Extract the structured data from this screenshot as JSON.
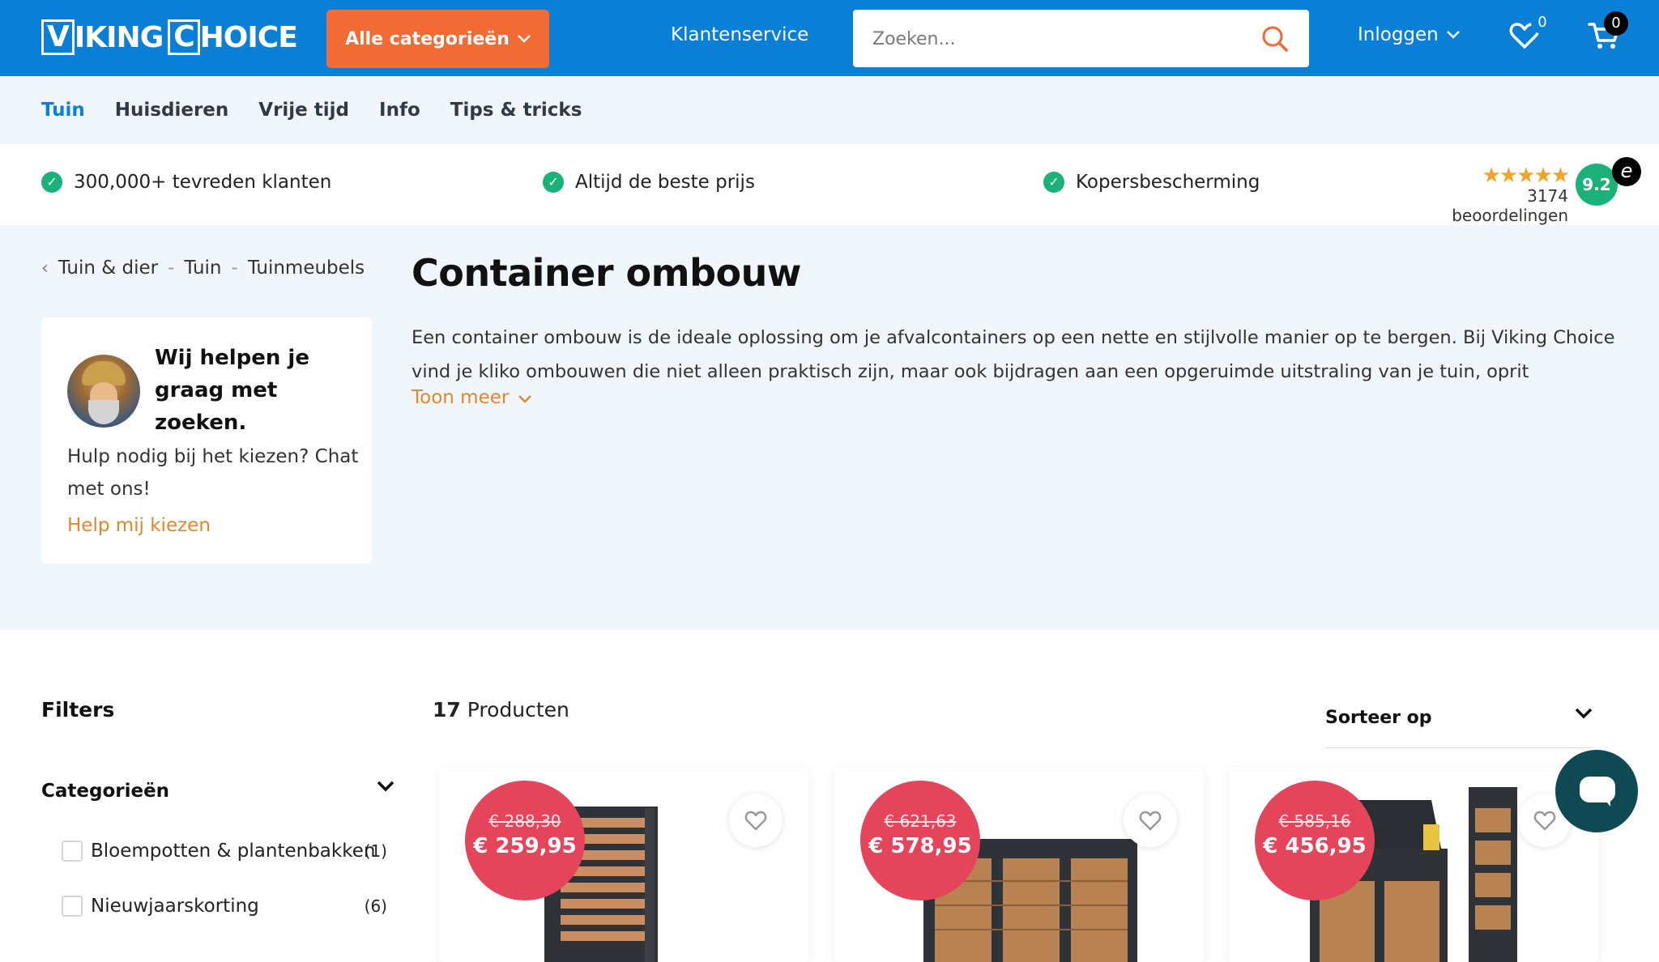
{
  "header": {
    "logo_text_1": "V",
    "logo_text_2": "IKING",
    "logo_text_3": "C",
    "logo_text_4": "HOICE",
    "categories_label": "Alle categorieën",
    "service_label": "Klantenservice",
    "search_placeholder": "Zoeken...",
    "login_label": "Inloggen",
    "wishlist_count": "0",
    "cart_count": "0",
    "brand_color": "#0a7fd6",
    "accent_color": "#f26b34"
  },
  "nav": {
    "items": [
      {
        "label": "Tuin"
      },
      {
        "label": "Huisdieren"
      },
      {
        "label": "Vrije tijd"
      },
      {
        "label": "Info"
      },
      {
        "label": "Tips & tricks"
      }
    ]
  },
  "usp": {
    "items": [
      {
        "label": "300,000+ tevreden klanten"
      },
      {
        "label": "Altijd de beste prijs"
      },
      {
        "label": "Kopersbescherming"
      }
    ],
    "stars": "★★★★★",
    "reviews": "3174 beoordelingen",
    "score": "9.2",
    "trust_mark": "e"
  },
  "breadcrumb": {
    "items": [
      {
        "label": "Tuin & dier"
      },
      {
        "label": "Tuin"
      },
      {
        "label": "Tuinmeubels"
      }
    ]
  },
  "help": {
    "title": "Wij helpen je graag met zoeken.",
    "text": "Hulp nodig bij het kiezen? Chat met ons!",
    "link": "Help mij kiezen"
  },
  "main": {
    "title": "Container ombouw",
    "description": "Een container ombouw is de ideale oplossing om je afvalcontainers op een nette en stijlvolle manier op te bergen. Bij Viking Choice vind je kliko ombouwen die niet alleen praktisch zijn, maar ook bijdragen aan een opgeruimde uitstraling van je tuin, oprit",
    "more_label": "Toon meer"
  },
  "filters": {
    "title": "Filters",
    "category_heading": "Categorieën",
    "options": [
      {
        "label": "Bloempotten & plantenbakken",
        "count": "(1)"
      },
      {
        "label": "Nieuwjaarskorting",
        "count": "(6)"
      }
    ]
  },
  "listing": {
    "count": "17",
    "count_label": "Producten",
    "sort_label": "Sorteer op",
    "products": [
      {
        "old_price": "€ 288,30",
        "price": "€ 259,95"
      },
      {
        "old_price": "€ 621,63",
        "price": "€ 578,95"
      },
      {
        "old_price": "€ 585,16",
        "price": "€ 456,95"
      }
    ]
  }
}
